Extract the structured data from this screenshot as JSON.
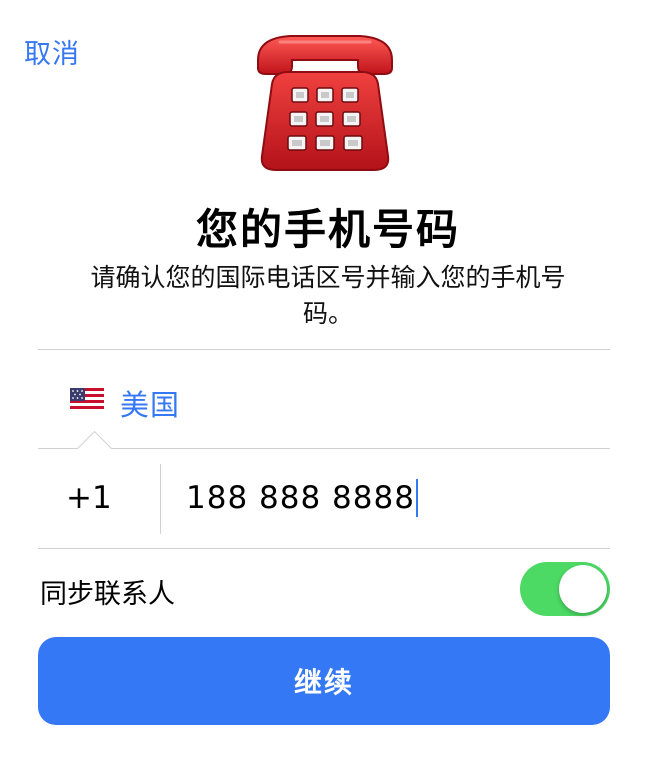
{
  "colors": {
    "accent": "#3478f6",
    "toggle_on": "#4cd964",
    "divider": "#d0d0d4"
  },
  "header": {
    "cancel_label": "取消",
    "icon": "telephone-icon"
  },
  "main": {
    "title": "您的手机号码",
    "subtitle": "请确认您的国际电话区号并输入您的手机号码。"
  },
  "country": {
    "flag_icon": "us-flag-icon",
    "name": "美国"
  },
  "phone": {
    "dial_code": "+1",
    "value": "188 888 8888"
  },
  "sync_contacts": {
    "label": "同步联系人",
    "enabled": true
  },
  "actions": {
    "continue_label": "继续"
  }
}
